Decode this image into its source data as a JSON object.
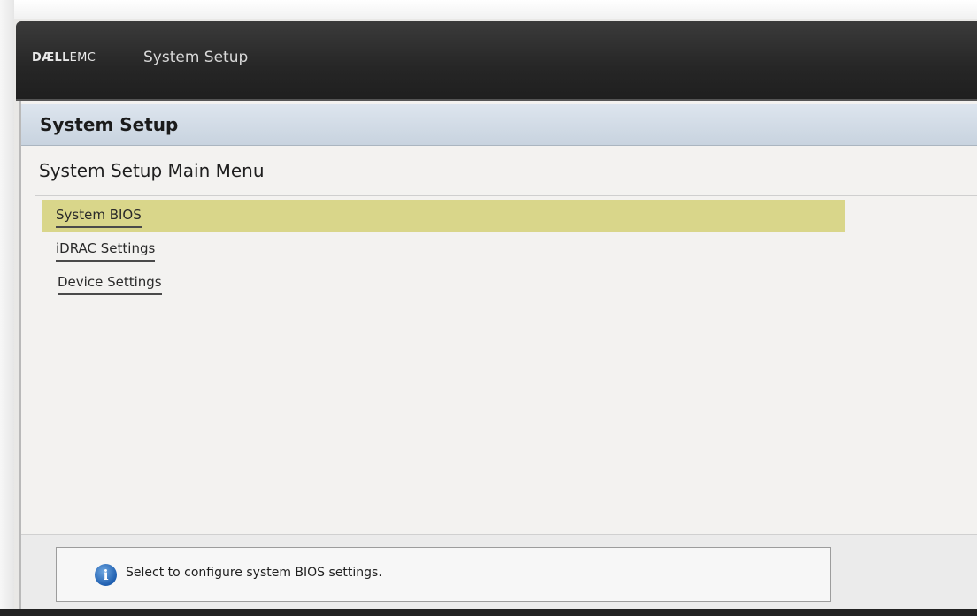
{
  "header": {
    "brand_bold": "DÆLL",
    "brand_light": "EMC",
    "title": "System Setup"
  },
  "panel": {
    "title": "System Setup",
    "menu_title": "System Setup Main Menu",
    "menu_items": [
      {
        "label": "System BIOS",
        "selected": true
      },
      {
        "label": "iDRAC Settings",
        "selected": false
      },
      {
        "label": "Device Settings",
        "selected": false
      }
    ]
  },
  "help": {
    "icon": "info-icon",
    "text": "Select to configure system BIOS settings."
  },
  "colors": {
    "selected_item": "#d9d68a",
    "header_bar": "#262626",
    "info_icon": "#1f5fb0"
  }
}
